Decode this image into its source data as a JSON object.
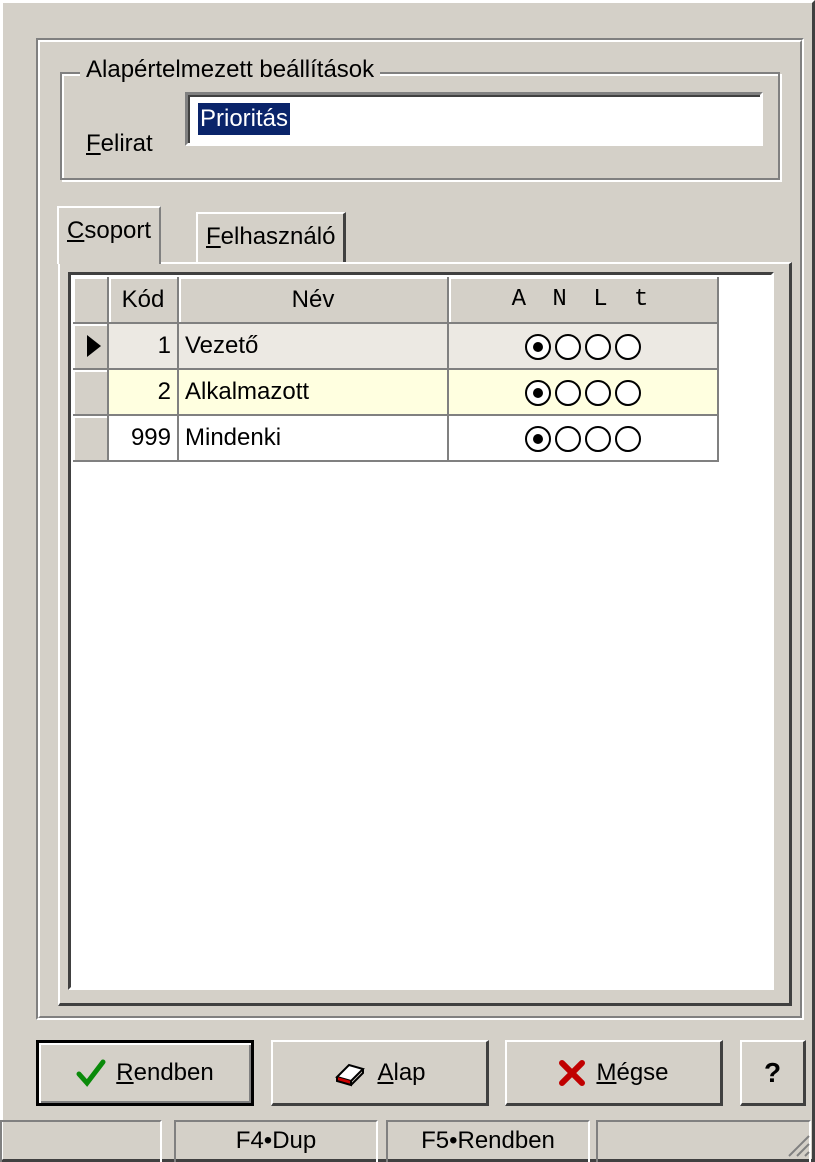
{
  "defaults_group": {
    "legend": "Alapértelmezett beállítások",
    "caption_label_accel": "F",
    "caption_label_rest": "elirat",
    "caption_value": "Prioritás"
  },
  "tabs": [
    {
      "accel": "C",
      "rest": "soport",
      "active": true
    },
    {
      "accel": "F",
      "rest": "elhasználó",
      "active": false
    }
  ],
  "grid": {
    "columns": [
      "Kód",
      "Név",
      "A N L t"
    ],
    "rows": [
      {
        "code": "1",
        "name": "Vezető",
        "selected_option": 1
      },
      {
        "code": "2",
        "name": "Alkalmazott",
        "selected_option": 1
      },
      {
        "code": "999",
        "name": "Mindenki",
        "selected_option": 1
      }
    ],
    "current_row": 1
  },
  "buttons": {
    "ok": {
      "accel": "R",
      "rest": "endben"
    },
    "alap": {
      "accel": "A",
      "rest": "lap"
    },
    "cancel": {
      "accel": "M",
      "rest": "égse"
    },
    "help": "?"
  },
  "statusbar": [
    "",
    "F4•Dup",
    "F5•Rendben",
    ""
  ]
}
